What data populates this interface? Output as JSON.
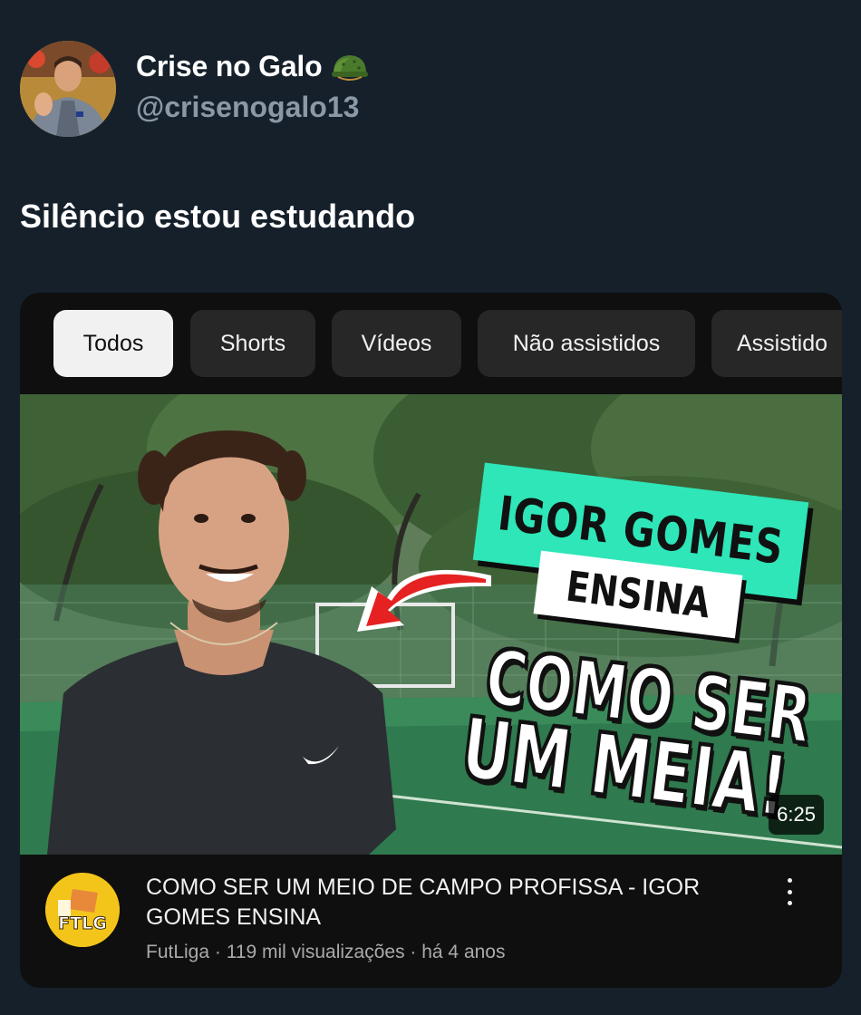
{
  "tweet": {
    "author_name": "Crise no Galo",
    "handle": "@crisenogalo13",
    "name_emoji_icon": "military-helmet-icon",
    "text": "Silêncio estou estudando"
  },
  "embedded": {
    "chips": [
      {
        "label": "Todos",
        "active": true
      },
      {
        "label": "Shorts",
        "active": false
      },
      {
        "label": "Vídeos",
        "active": false
      },
      {
        "label": "Não assistidos",
        "active": false
      },
      {
        "label": "Assistido",
        "active": false
      }
    ],
    "thumbnail": {
      "banner_line1": "IGOR GOMES",
      "banner_line2": "ENSINA",
      "headline_line1": "COMO SER",
      "headline_line2": "UM MEIA!",
      "duration": "6:25"
    },
    "video": {
      "title": "COMO SER UM MEIO DE CAMPO PROFISSA - IGOR GOMES ENSINA",
      "channel_logo_text": "FTLG",
      "subtitle": "FutLiga · 119 mil visualizações · há 4 anos"
    }
  },
  "colors": {
    "background": "#15202b",
    "handle_gray": "#8b98a5",
    "banner_green": "#2ee6b8",
    "arrow_red": "#e62121",
    "channel_yellow": "#f3c51a"
  }
}
